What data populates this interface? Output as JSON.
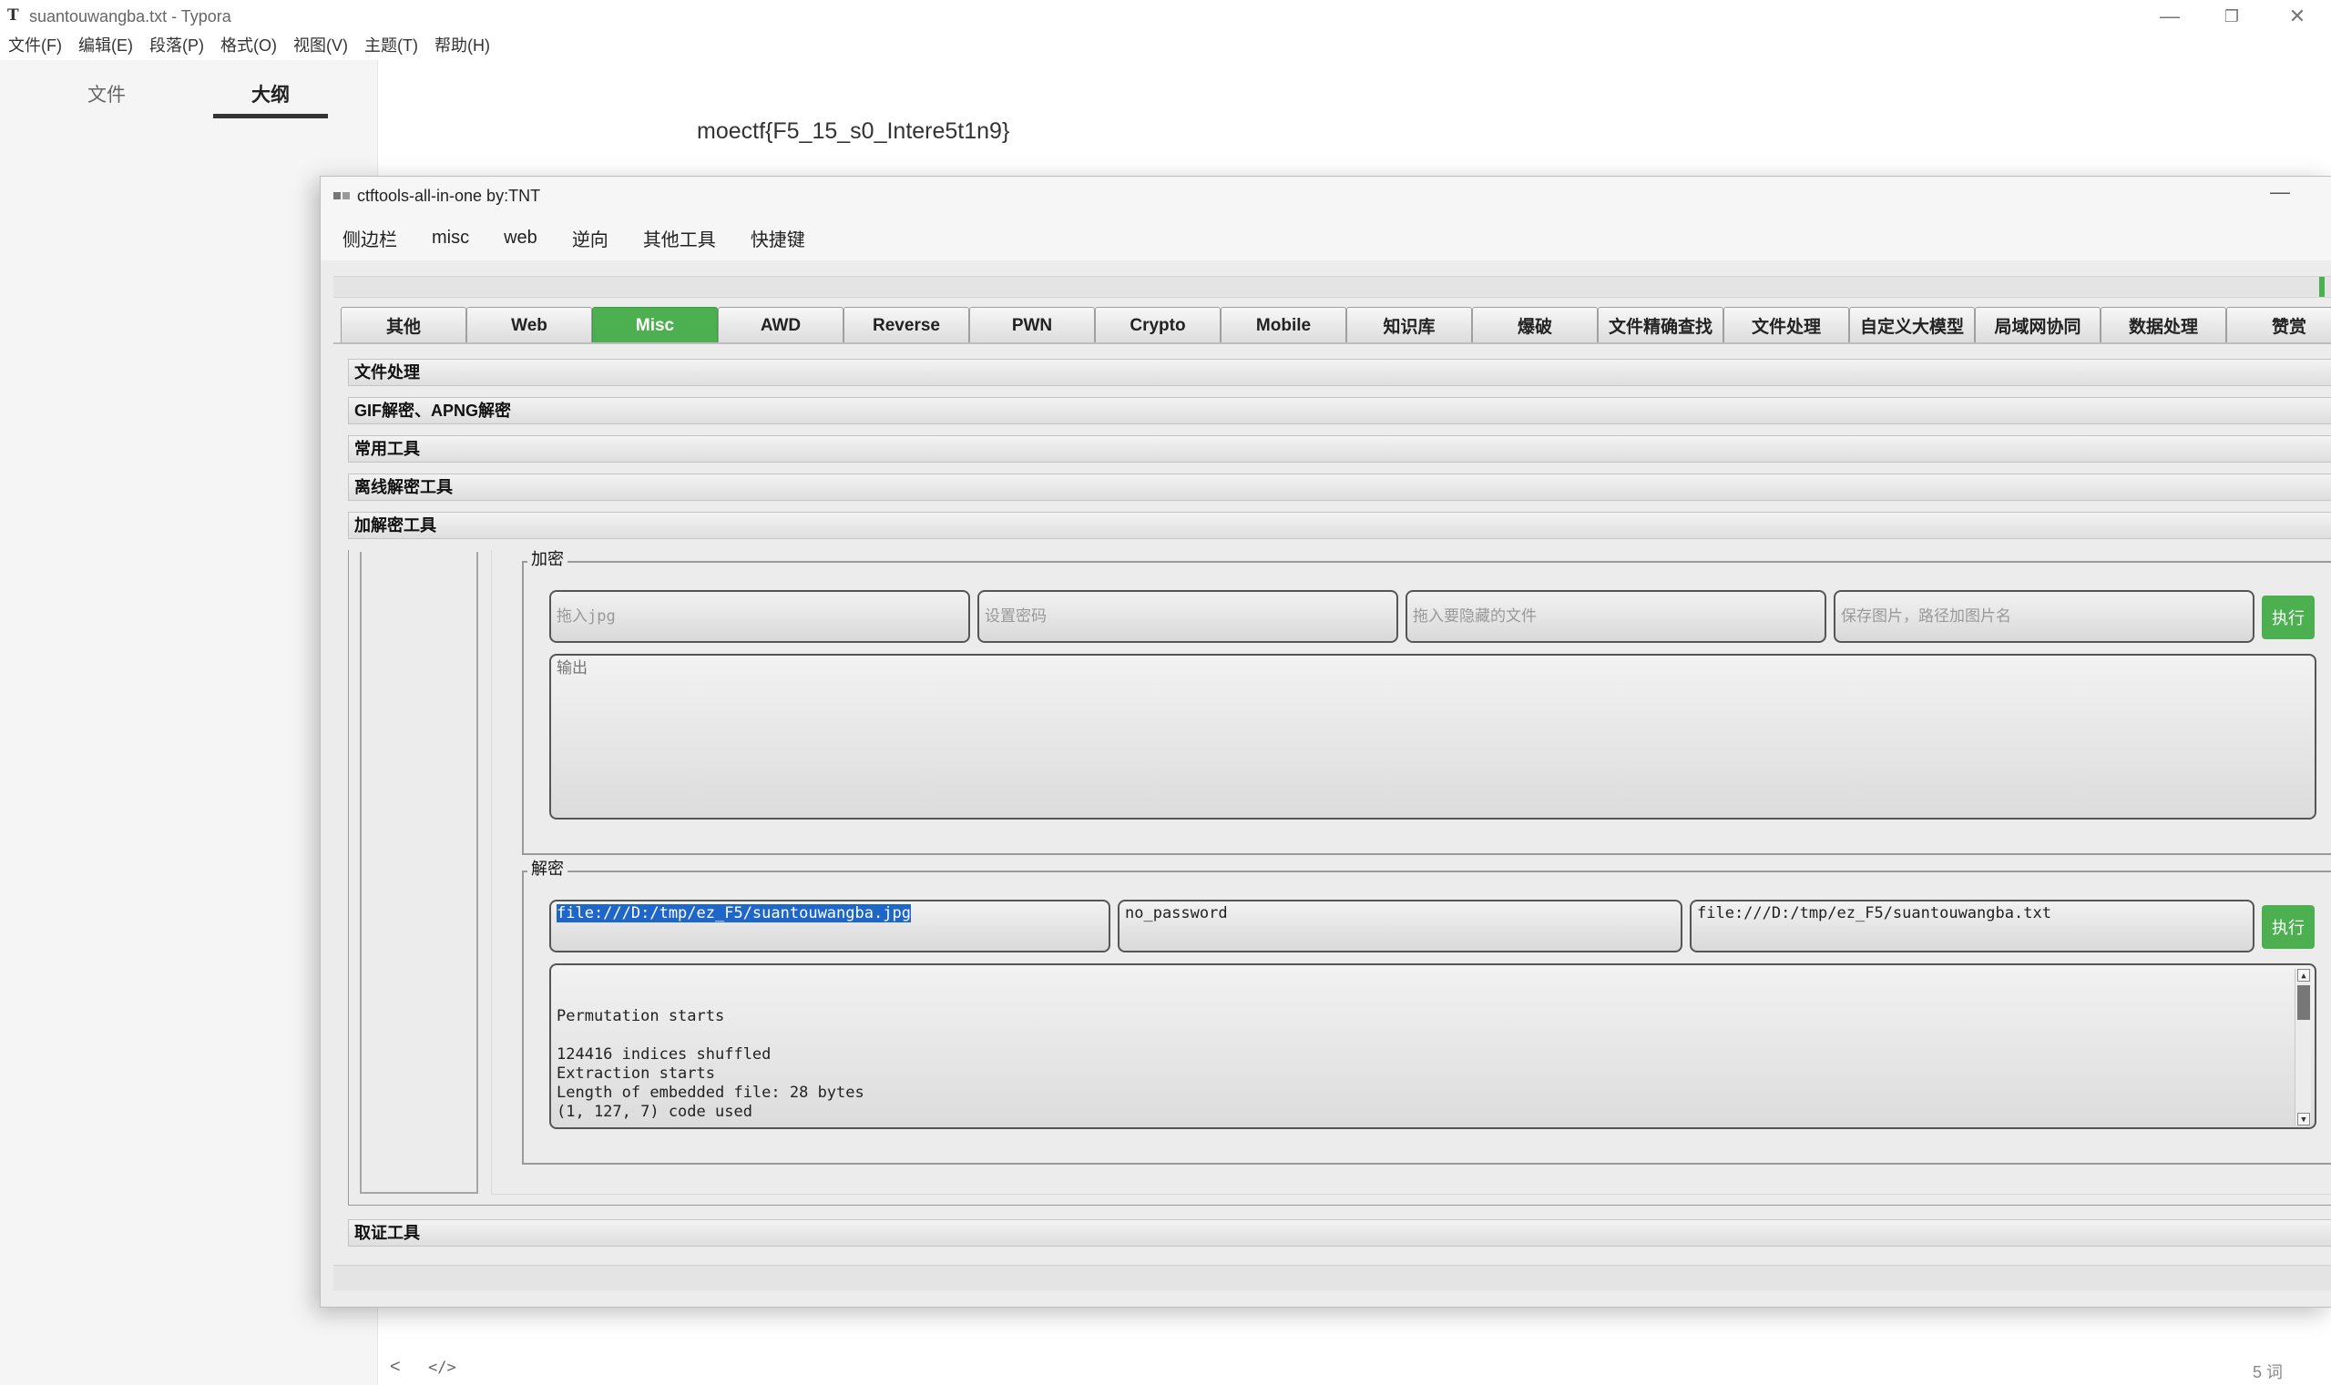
{
  "typora": {
    "title": "suantouwangba.txt - Typora",
    "app_icon": "T",
    "menu": [
      "文件(F)",
      "编辑(E)",
      "段落(P)",
      "格式(O)",
      "视图(V)",
      "主题(T)",
      "帮助(H)"
    ],
    "sidebar_tabs": {
      "files": "文件",
      "outline": "大纲"
    },
    "document_text": "moectf{F5_15_s0_Intere5t1n9}",
    "status": {
      "word_count": "5 词",
      "code_toggle": "</>",
      "back": "<"
    },
    "window_controls": {
      "minimize": "—",
      "maximize": "❐",
      "close": "✕"
    }
  },
  "ctftools": {
    "title": "ctftools-all-in-one   by:TNT",
    "minimize": "—",
    "menu": [
      "侧边栏",
      "misc",
      "web",
      "逆向",
      "其他工具",
      "快捷键"
    ],
    "tabs": [
      "其他",
      "Web",
      "Misc",
      "AWD",
      "Reverse",
      "PWN",
      "Crypto",
      "Mobile",
      "知识库",
      "爆破",
      "文件精确查找",
      "文件处理",
      "自定义大模型",
      "局域网协同",
      "数据处理",
      "赞赏"
    ],
    "active_tab": "Misc",
    "accent": "#4caf50",
    "sections": [
      "文件处理",
      "GIF解密、APNG解密",
      "常用工具",
      "离线解密工具",
      "加解密工具"
    ],
    "bottom_section": "取证工具",
    "encrypt": {
      "title": "加密",
      "jpg_placeholder": "拖入jpg",
      "password_placeholder": "设置密码",
      "hidden_file_placeholder": "拖入要隐藏的文件",
      "save_placeholder": "保存图片，路径加图片名",
      "execute": "执行",
      "output_placeholder": "输出"
    },
    "decrypt": {
      "title": "解密",
      "jpg_value": "file:///D:/tmp/ez_F5/suantouwangba.jpg",
      "password_value": "no_password",
      "output_path_value": "file:///D:/tmp/ez_F5/suantouwangba.txt",
      "execute": "执行",
      "output_lines": "Permutation starts\n\n124416 indices shuffled\nExtraction starts\nLength of embedded file: 28 bytes\n(1, 127, 7) code used"
    }
  }
}
